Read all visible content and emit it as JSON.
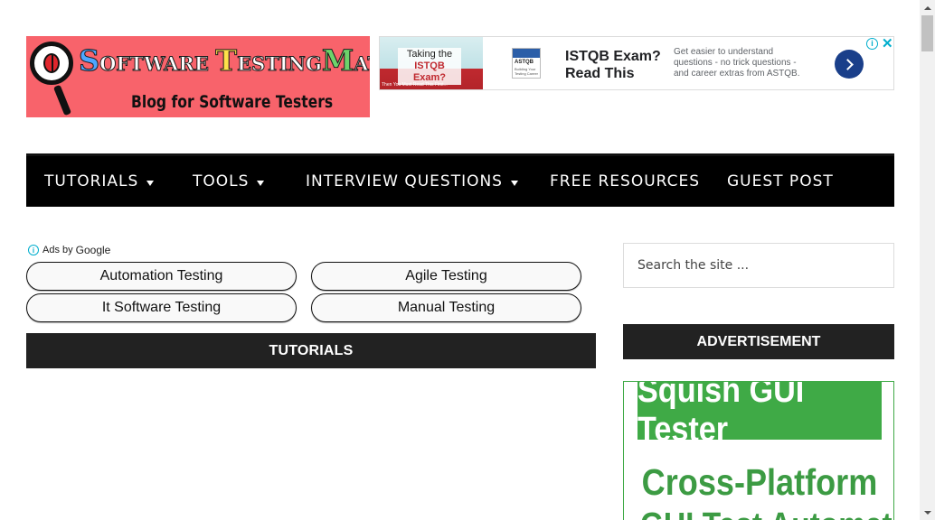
{
  "logo": {
    "title_s": "S",
    "title_oftware": "OFTWARE ",
    "title_t": "T",
    "title_esting": "ESTING",
    "title_m": "M",
    "title_aterial": "ATERIAL",
    "subtitle": "Blog for Software Testers"
  },
  "top_ad": {
    "thumb_line1": "Taking the",
    "thumb_line2": "ISTQB Exam?",
    "thumb_footer": "Then You Must Read This First...",
    "brand_logo": "ASTQB",
    "brand_tagline": "Building Your Testing Career",
    "headline_line1": "ISTQB Exam?",
    "headline_line2": "Read This",
    "description": "Get easier to understand questions - no trick questions - and career extras from ASTQB."
  },
  "nav": {
    "items": [
      {
        "label": "TUTORIALS",
        "dropdown": true
      },
      {
        "label": "TOOLS",
        "dropdown": true
      },
      {
        "label": "INTERVIEW QUESTIONS",
        "dropdown": true
      },
      {
        "label": "FREE RESOURCES",
        "dropdown": false
      },
      {
        "label": "GUEST POST",
        "dropdown": false
      }
    ]
  },
  "ads_by": {
    "prefix": "Ads by",
    "brand": "Google"
  },
  "ad_links": [
    "Automation Testing",
    "Agile Testing",
    "It Software Testing",
    "Manual Testing"
  ],
  "main": {
    "section_title": "TUTORIALS"
  },
  "sidebar": {
    "search_placeholder": "Search the site ...",
    "advert_title": "ADVERTISEMENT",
    "squish_title": "Squish GUI Tester",
    "squish_line1": "Cross-Platform",
    "squish_line2": "GUI Test Automation"
  },
  "colors": {
    "logo_bg": "#f8636b",
    "nav_bg": "#000000",
    "section_bar_bg": "#222222",
    "squish_green": "#3faa46",
    "ad_button": "#1a3f8a",
    "ad_info": "#00aecd"
  }
}
